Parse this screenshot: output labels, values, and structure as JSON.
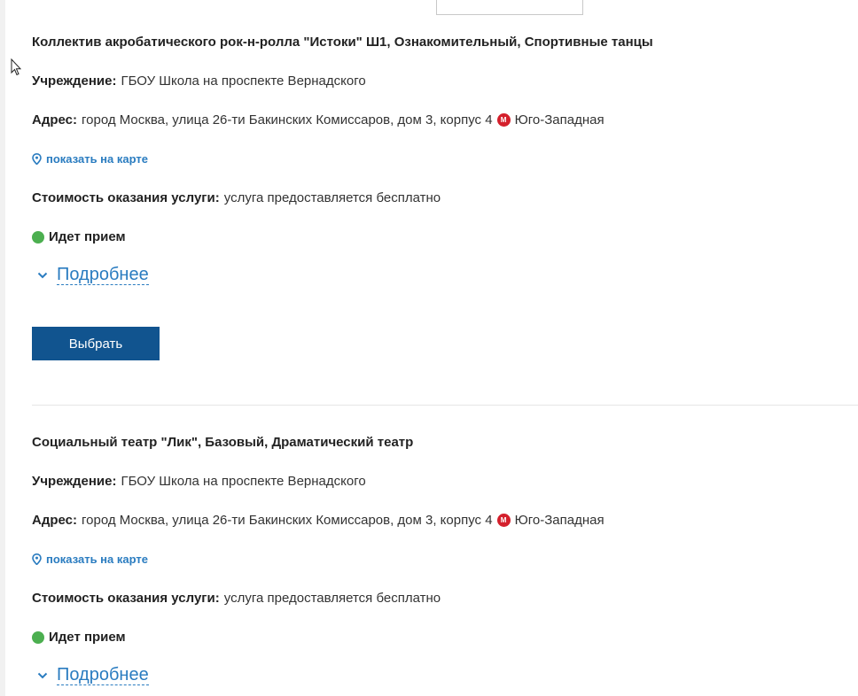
{
  "labels": {
    "institution": "Учреждение:",
    "address": "Адрес:",
    "cost": "Стоимость оказания услуги:"
  },
  "cards": [
    {
      "title": "Коллектив акробатического рок-н-ролла \"Истоки\" Ш1, Ознакомительный, Спортивные танцы",
      "institution": "ГБОУ Школа на проспекте Вернадского",
      "address": "город Москва, улица 26-ти Бакинских Комиссаров, дом 3, корпус 4",
      "metro_letter": "М",
      "metro": "Юго-Западная",
      "map_link": "показать на карте",
      "cost": "услуга предоставляется бесплатно",
      "status": "Идет прием",
      "more": "Подробнее",
      "select_button": "Выбрать"
    },
    {
      "title": "Социальный театр \"Лик\", Базовый, Драматический театр",
      "institution": "ГБОУ Школа на проспекте Вернадского",
      "address": "город Москва, улица 26-ти Бакинских Комиссаров, дом 3, корпус 4",
      "metro_letter": "М",
      "metro": "Юго-Западная",
      "map_link": "показать на карте",
      "cost": "услуга предоставляется бесплатно",
      "status": "Идет прием",
      "more": "Подробнее"
    }
  ],
  "colors": {
    "link": "#2a7cc0",
    "button": "#11548f",
    "status_open": "#4caf50",
    "metro": "#d4202c"
  }
}
